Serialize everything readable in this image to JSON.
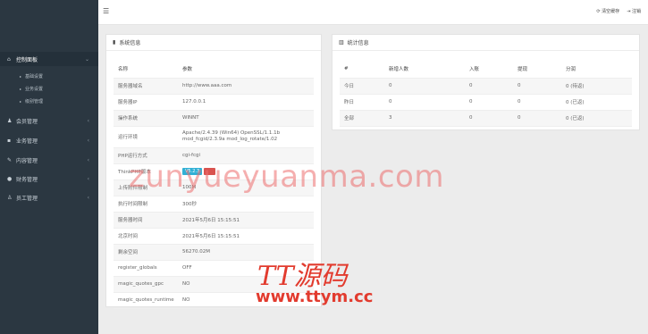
{
  "sidebar": {
    "items": [
      {
        "icon": "home-icon",
        "label": "控制面板"
      },
      {
        "label": "基础设置"
      },
      {
        "label": "业务设置"
      },
      {
        "label": "级别管理"
      },
      {
        "icon": "user-icon",
        "label": "会员管理"
      },
      {
        "icon": "briefcase-icon",
        "label": "业务管理"
      },
      {
        "icon": "edit-icon",
        "label": "内容管理"
      },
      {
        "icon": "money-icon",
        "label": "财务管理"
      },
      {
        "icon": "staff-icon",
        "label": "员工管理"
      }
    ]
  },
  "topbar": {
    "menu_toggle": "☰",
    "clear_cache": "清空缓存",
    "logout": "注销"
  },
  "system_panel": {
    "title": "系统信息",
    "header": [
      "名称",
      "参数"
    ],
    "rows": [
      [
        "服务器域名",
        "http://www.aaa.com"
      ],
      [
        "服务器IP",
        "127.0.0.1"
      ],
      [
        "操作系统",
        "WINNT"
      ],
      [
        "运行环境",
        "Apache/2.4.39 (Win64) OpenSSL/1.1.1b mod_fcgid/2.3.9a mod_log_rotate/1.02"
      ],
      [
        "PHP运行方式",
        "cgi-fcgi"
      ],
      [
        "ThinkPHP版本",
        "V5.2.3"
      ],
      [
        "上传附件限制",
        "100M"
      ],
      [
        "执行时间限制",
        "300秒"
      ],
      [
        "服务器时间",
        "2021年5月6日 15:15:51"
      ],
      [
        "北京时间",
        "2021年5月6日 15:15:51"
      ],
      [
        "剩余空间",
        "56270.02M"
      ],
      [
        "register_globals",
        "OFF"
      ],
      [
        "magic_quotes_gpc",
        "NO"
      ],
      [
        "magic_quotes_runtime",
        "NO"
      ]
    ]
  },
  "stats_panel": {
    "title": "统计信息",
    "header": [
      "#",
      "新增人数",
      "入账",
      "提现",
      "分润"
    ],
    "rows": [
      [
        "今日",
        "0",
        "0",
        "0",
        "0 (待返)"
      ],
      [
        "昨日",
        "0",
        "0",
        "0",
        "0 (已返)"
      ],
      [
        "全部",
        "3",
        "0",
        "0",
        "0 (已返)"
      ]
    ]
  },
  "watermark": {
    "text": "zunyueyuanma.com",
    "logo": "TT源码",
    "logo_url": "www.ttym.cc"
  }
}
